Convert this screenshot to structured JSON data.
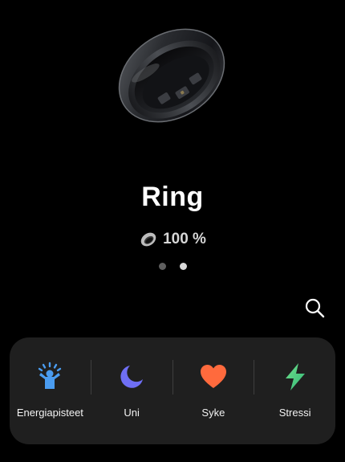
{
  "device": {
    "name": "Ring",
    "battery": "100 %",
    "battery_level": 1.0
  },
  "pager": {
    "pages": 2,
    "active_index": 1
  },
  "toolbar": {
    "search_icon": "search-icon"
  },
  "tiles": [
    {
      "label": "Energiapisteet",
      "icon": "energy-person-icon",
      "color": "#4a9cf0"
    },
    {
      "label": "Uni",
      "icon": "moon-icon",
      "color": "#6f6ff5"
    },
    {
      "label": "Syke",
      "icon": "heart-icon",
      "color": "#ff6a3d"
    },
    {
      "label": "Stressi",
      "icon": "lightning-icon",
      "color": "#4fd08a"
    }
  ],
  "colors": {
    "background": "#000000",
    "card": "#1f1f1f",
    "dot_inactive": "#5f5f5f",
    "dot_active": "#d9d9d9"
  }
}
